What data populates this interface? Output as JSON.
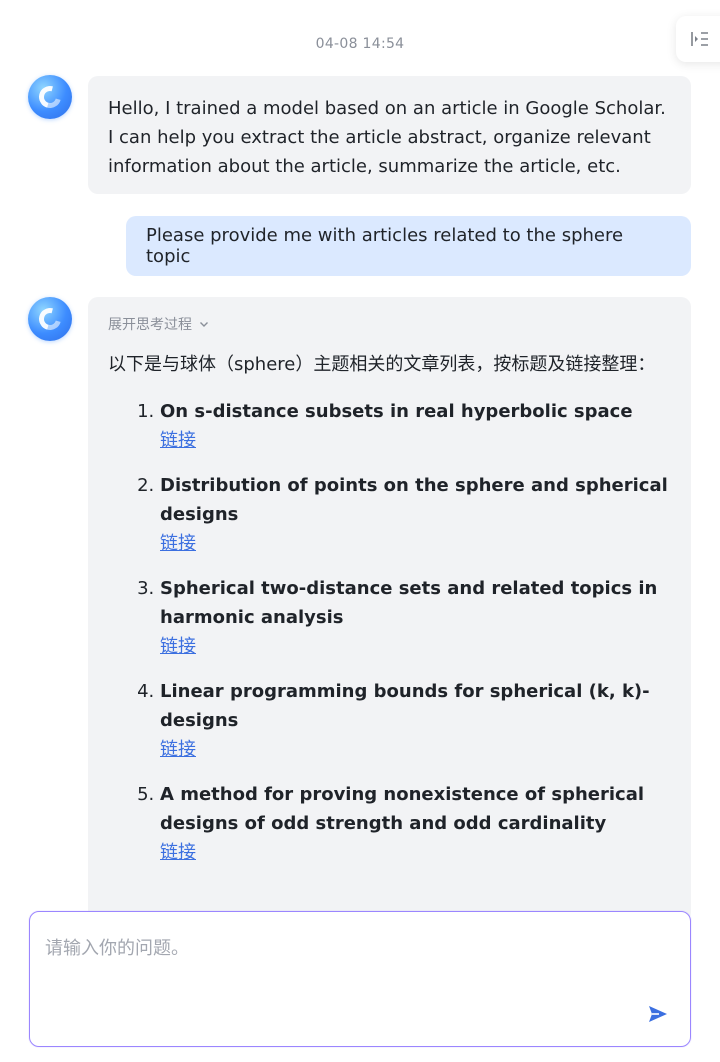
{
  "header": {
    "timestamp": "04-08 14:54"
  },
  "messages": {
    "greeting": "Hello, I trained a model based on an article in Google Scholar. I can help you extract the article abstract, organize relevant information about the article, summarize the article, etc.",
    "user_query": "Please provide me with articles related to the sphere topic",
    "reply": {
      "think_toggle": "展开思考过程",
      "intro": "以下是与球体（sphere）主题相关的文章列表，按标题及链接整理：",
      "articles": [
        {
          "title": "On s-distance subsets in real hyperbolic space",
          "link": "链接"
        },
        {
          "title": "Distribution of points on the sphere and spherical designs",
          "link": "链接"
        },
        {
          "title": "Spherical two-distance sets and related topics in harmonic analysis",
          "link": "链接"
        },
        {
          "title": "Linear programming bounds for spherical (k, k)-designs",
          "link": "链接"
        },
        {
          "title": "A method for proving nonexistence of spherical designs of odd strength and odd cardinality",
          "link": "链接"
        }
      ]
    }
  },
  "composer": {
    "placeholder": "请输入你的问题。"
  },
  "icons": {
    "sidebar_toggle": "sidebar-toggle-icon",
    "avatar": "assistant-avatar",
    "chevron": "chevron-down-icon",
    "send": "send-icon"
  },
  "colors": {
    "accent": "#3b6fe0",
    "user_bubble": "#dbe9ff",
    "ai_bubble": "#f2f3f5",
    "input_border": "#9b86ff"
  }
}
